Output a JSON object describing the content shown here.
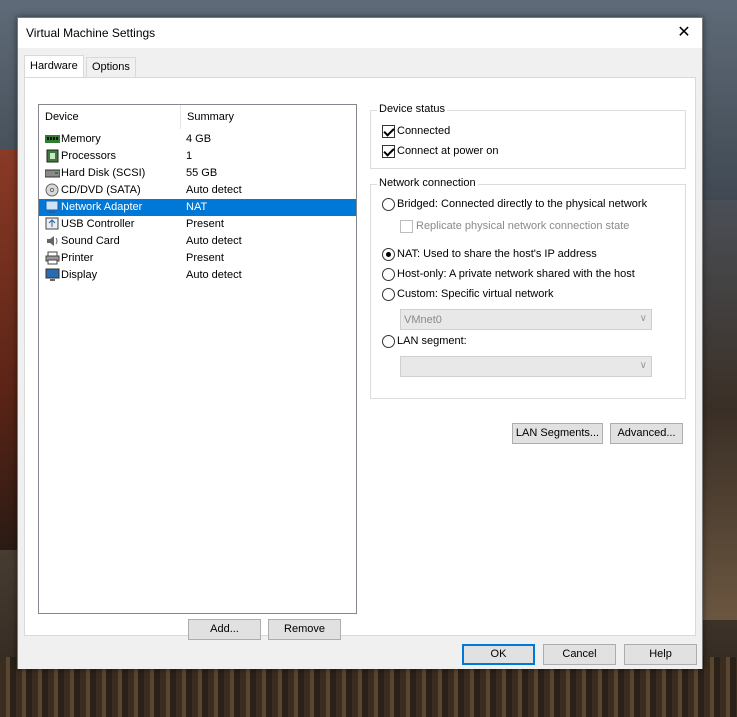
{
  "window": {
    "title": "Virtual Machine Settings",
    "close_glyph": "✕"
  },
  "tabs": [
    {
      "label": "Hardware"
    },
    {
      "label": "Options"
    }
  ],
  "device_list": {
    "columns": [
      "Device",
      "Summary"
    ],
    "rows": [
      {
        "device": "Memory",
        "summary": "4 GB",
        "icon": "memory-icon"
      },
      {
        "device": "Processors",
        "summary": "1",
        "icon": "processor-icon"
      },
      {
        "device": "Hard Disk (SCSI)",
        "summary": "55 GB",
        "icon": "hard-disk-icon"
      },
      {
        "device": "CD/DVD (SATA)",
        "summary": "Auto detect",
        "icon": "cd-dvd-icon"
      },
      {
        "device": "Network Adapter",
        "summary": "NAT",
        "icon": "network-adapter-icon",
        "selected": true
      },
      {
        "device": "USB Controller",
        "summary": "Present",
        "icon": "usb-icon"
      },
      {
        "device": "Sound Card",
        "summary": "Auto detect",
        "icon": "speaker-icon"
      },
      {
        "device": "Printer",
        "summary": "Present",
        "icon": "printer-icon"
      },
      {
        "device": "Display",
        "summary": "Auto detect",
        "icon": "display-icon"
      }
    ],
    "add_label": "Add...",
    "remove_label": "Remove"
  },
  "device_status": {
    "title": "Device status",
    "connected": {
      "label": "Connected",
      "checked": true
    },
    "connect_at_power_on": {
      "label": "Connect at power on",
      "checked": true
    }
  },
  "network_connection": {
    "title": "Network connection",
    "bridged": "Bridged: Connected directly to the physical network",
    "replicate": "Replicate physical network connection state",
    "nat": "NAT: Used to share the host's IP address",
    "host_only": "Host-only: A private network shared with the host",
    "custom": "Custom: Specific virtual network",
    "custom_value": "VMnet0",
    "lan_segment": "LAN segment:",
    "lan_segment_value": "",
    "selected": "nat"
  },
  "actions": {
    "lan_segments": "LAN Segments...",
    "advanced": "Advanced..."
  },
  "footer": {
    "ok": "OK",
    "cancel": "Cancel",
    "help": "Help"
  },
  "colors": {
    "selection": "#0078d7",
    "focus_border": "#0078d7"
  }
}
